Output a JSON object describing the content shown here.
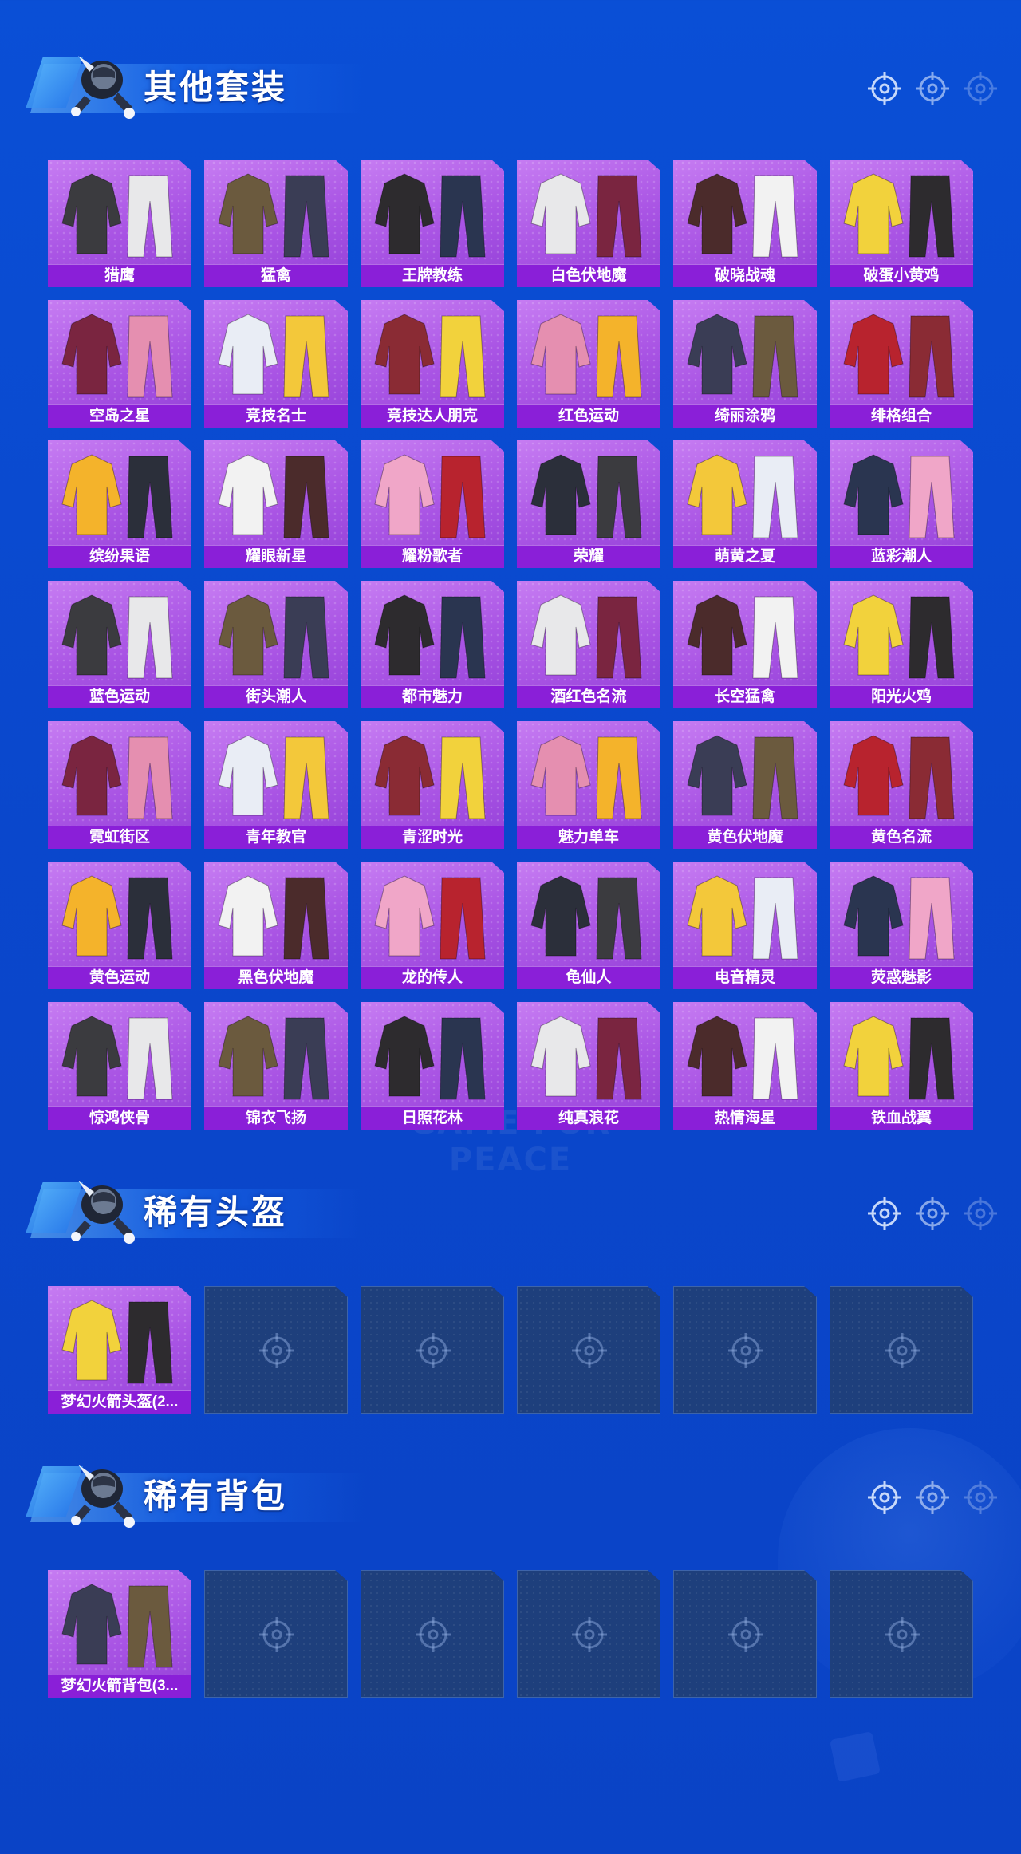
{
  "background": {
    "watermark_text": "GAME FOR PEACE"
  },
  "colors": {
    "page_bg": "#0a4fd6",
    "card_bg": "#a954e4",
    "card_label_bg": "#8a1fd8",
    "empty_slot_bg": "#1e3f7c"
  },
  "sections": [
    {
      "title": "其他套装",
      "icon": "soldier-mascot-icon",
      "items": [
        "猎鹰",
        "猛禽",
        "王牌教练",
        "白色伏地魔",
        "破晓战魂",
        "破蛋小黄鸡",
        "空岛之星",
        "竞技名士",
        "竞技达人朋克",
        "红色运动",
        "绮丽涂鸦",
        "绯格组合",
        "缤纷果语",
        "耀眼新星",
        "耀粉歌者",
        "荣耀",
        "萌黄之夏",
        "蓝彩潮人",
        "蓝色运动",
        "街头潮人",
        "都市魅力",
        "酒红色名流",
        "长空猛禽",
        "阳光火鸡",
        "霓虹街区",
        "青年教官",
        "青涩时光",
        "魅力单车",
        "黄色伏地魔",
        "黄色名流",
        "黄色运动",
        "黑色伏地魔",
        "龙的传人",
        "龟仙人",
        "电音精灵",
        "荧惑魅影",
        "惊鸿侠骨",
        "锦衣飞扬",
        "日照花林",
        "纯真浪花",
        "热情海星",
        "铁血战翼"
      ]
    },
    {
      "title": "稀有头盔",
      "icon": "soldier-mascot-icon",
      "items": [
        "梦幻火箭头盔(2..."
      ],
      "empty_slots": 5
    },
    {
      "title": "稀有背包",
      "icon": "soldier-mascot-icon",
      "items": [
        "梦幻火箭背包(3..."
      ],
      "empty_slots": 5
    }
  ]
}
